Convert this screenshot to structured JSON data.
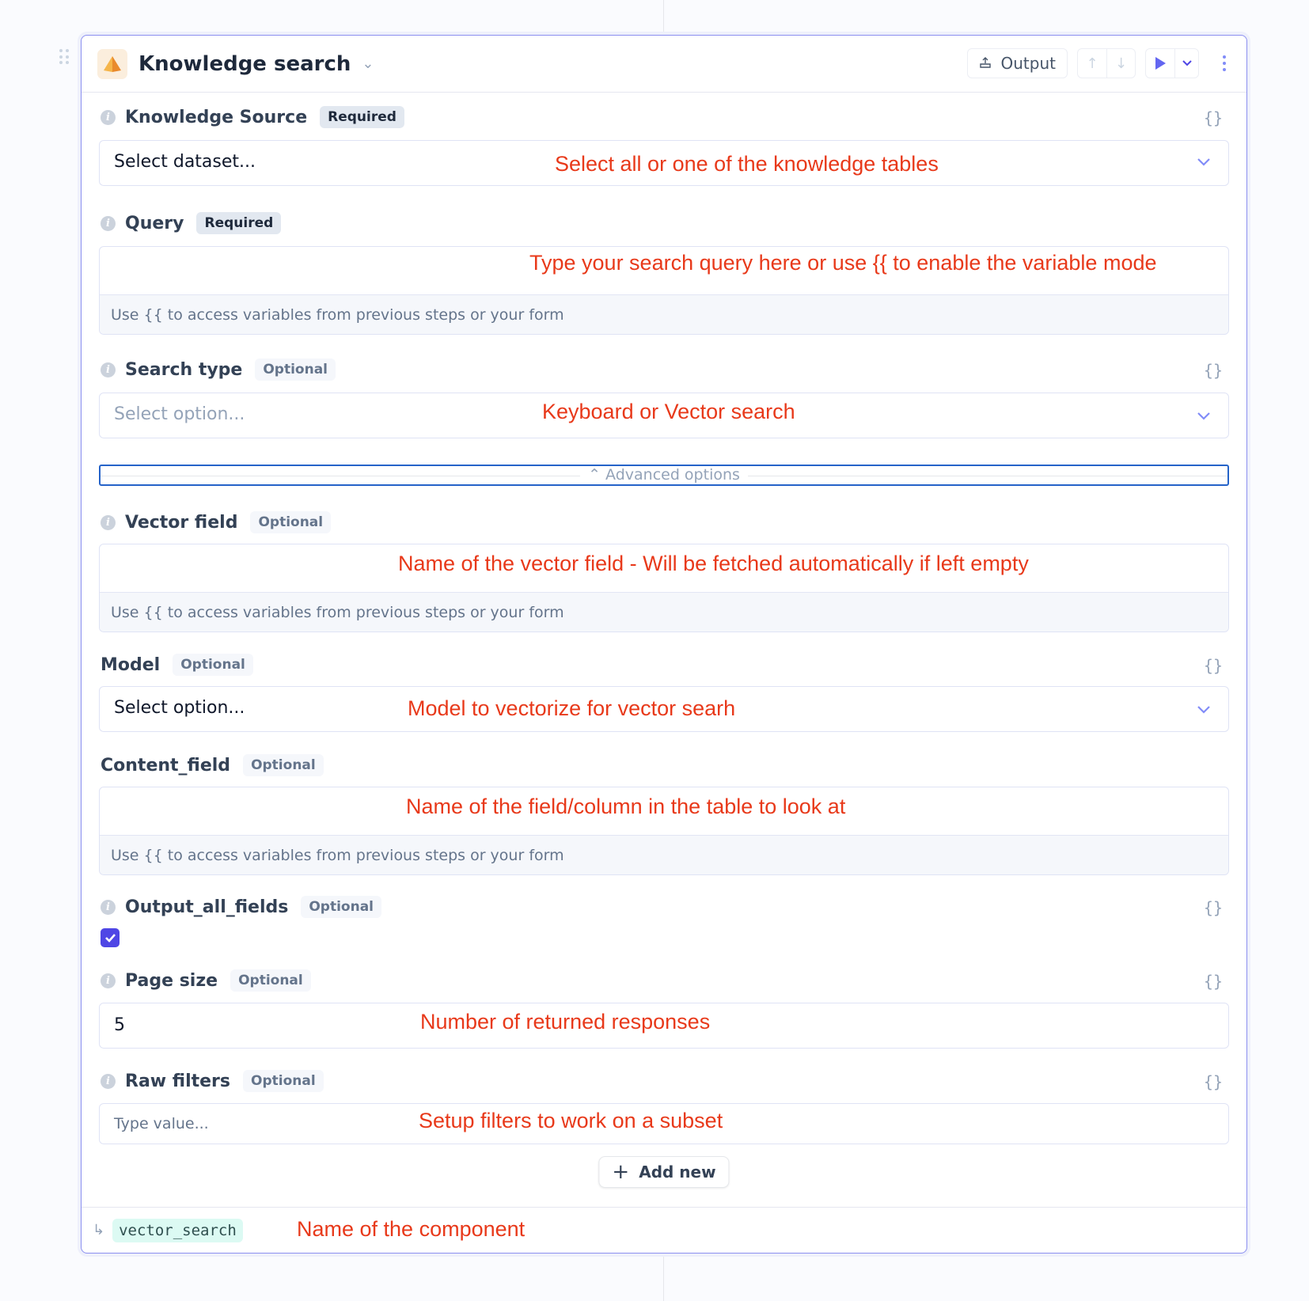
{
  "header": {
    "title": "Knowledge search",
    "output_label": "Output"
  },
  "fields": {
    "knowledge_source": {
      "label": "Knowledge Source",
      "badge": "Required",
      "value": "Select dataset...",
      "annotation": "Select all or one of the knowledge tables"
    },
    "query": {
      "label": "Query",
      "badge": "Required",
      "value": "",
      "annotation": "Type your search query here or use {{ to enable the variable mode",
      "hint": "Use {{ to access variables from previous steps or your form"
    },
    "search_type": {
      "label": "Search type",
      "badge": "Optional",
      "placeholder": "Select option...",
      "annotation": "Keyboard or Vector search"
    },
    "advanced_options": {
      "label": "Advanced options",
      "expanded": true
    },
    "vector_field": {
      "label": "Vector field",
      "badge": "Optional",
      "value": "",
      "annotation": "Name of the vector field - Will be fetched automatically if left empty",
      "hint": "Use {{ to access variables from previous steps or your form"
    },
    "model": {
      "label": "Model",
      "badge": "Optional",
      "value": "Select option...",
      "annotation": "Model to vectorize for vector searh"
    },
    "content_field": {
      "label": "Content_field",
      "badge": "Optional",
      "value": "",
      "annotation": "Name of the field/column in the table to look at",
      "hint": "Use {{ to access variables from previous steps or your form"
    },
    "output_all_fields": {
      "label": "Output_all_fields",
      "badge": "Optional",
      "checked": true
    },
    "page_size": {
      "label": "Page size",
      "badge": "Optional",
      "value": "5",
      "annotation": "Number of returned responses"
    },
    "raw_filters": {
      "label": "Raw filters",
      "badge": "Optional",
      "placeholder": "Type value...",
      "annotation": "Setup filters to work on a subset",
      "add_label": "Add new"
    }
  },
  "footer": {
    "component_name": "vector_search",
    "annotation": "Name of the component"
  },
  "icons": {
    "variable": "{}"
  },
  "colors": {
    "accent": "#4f46e5",
    "card_border": "#8b8ff0",
    "annotation": "#e8391a",
    "component_badge_bg": "#dcfaf3"
  }
}
